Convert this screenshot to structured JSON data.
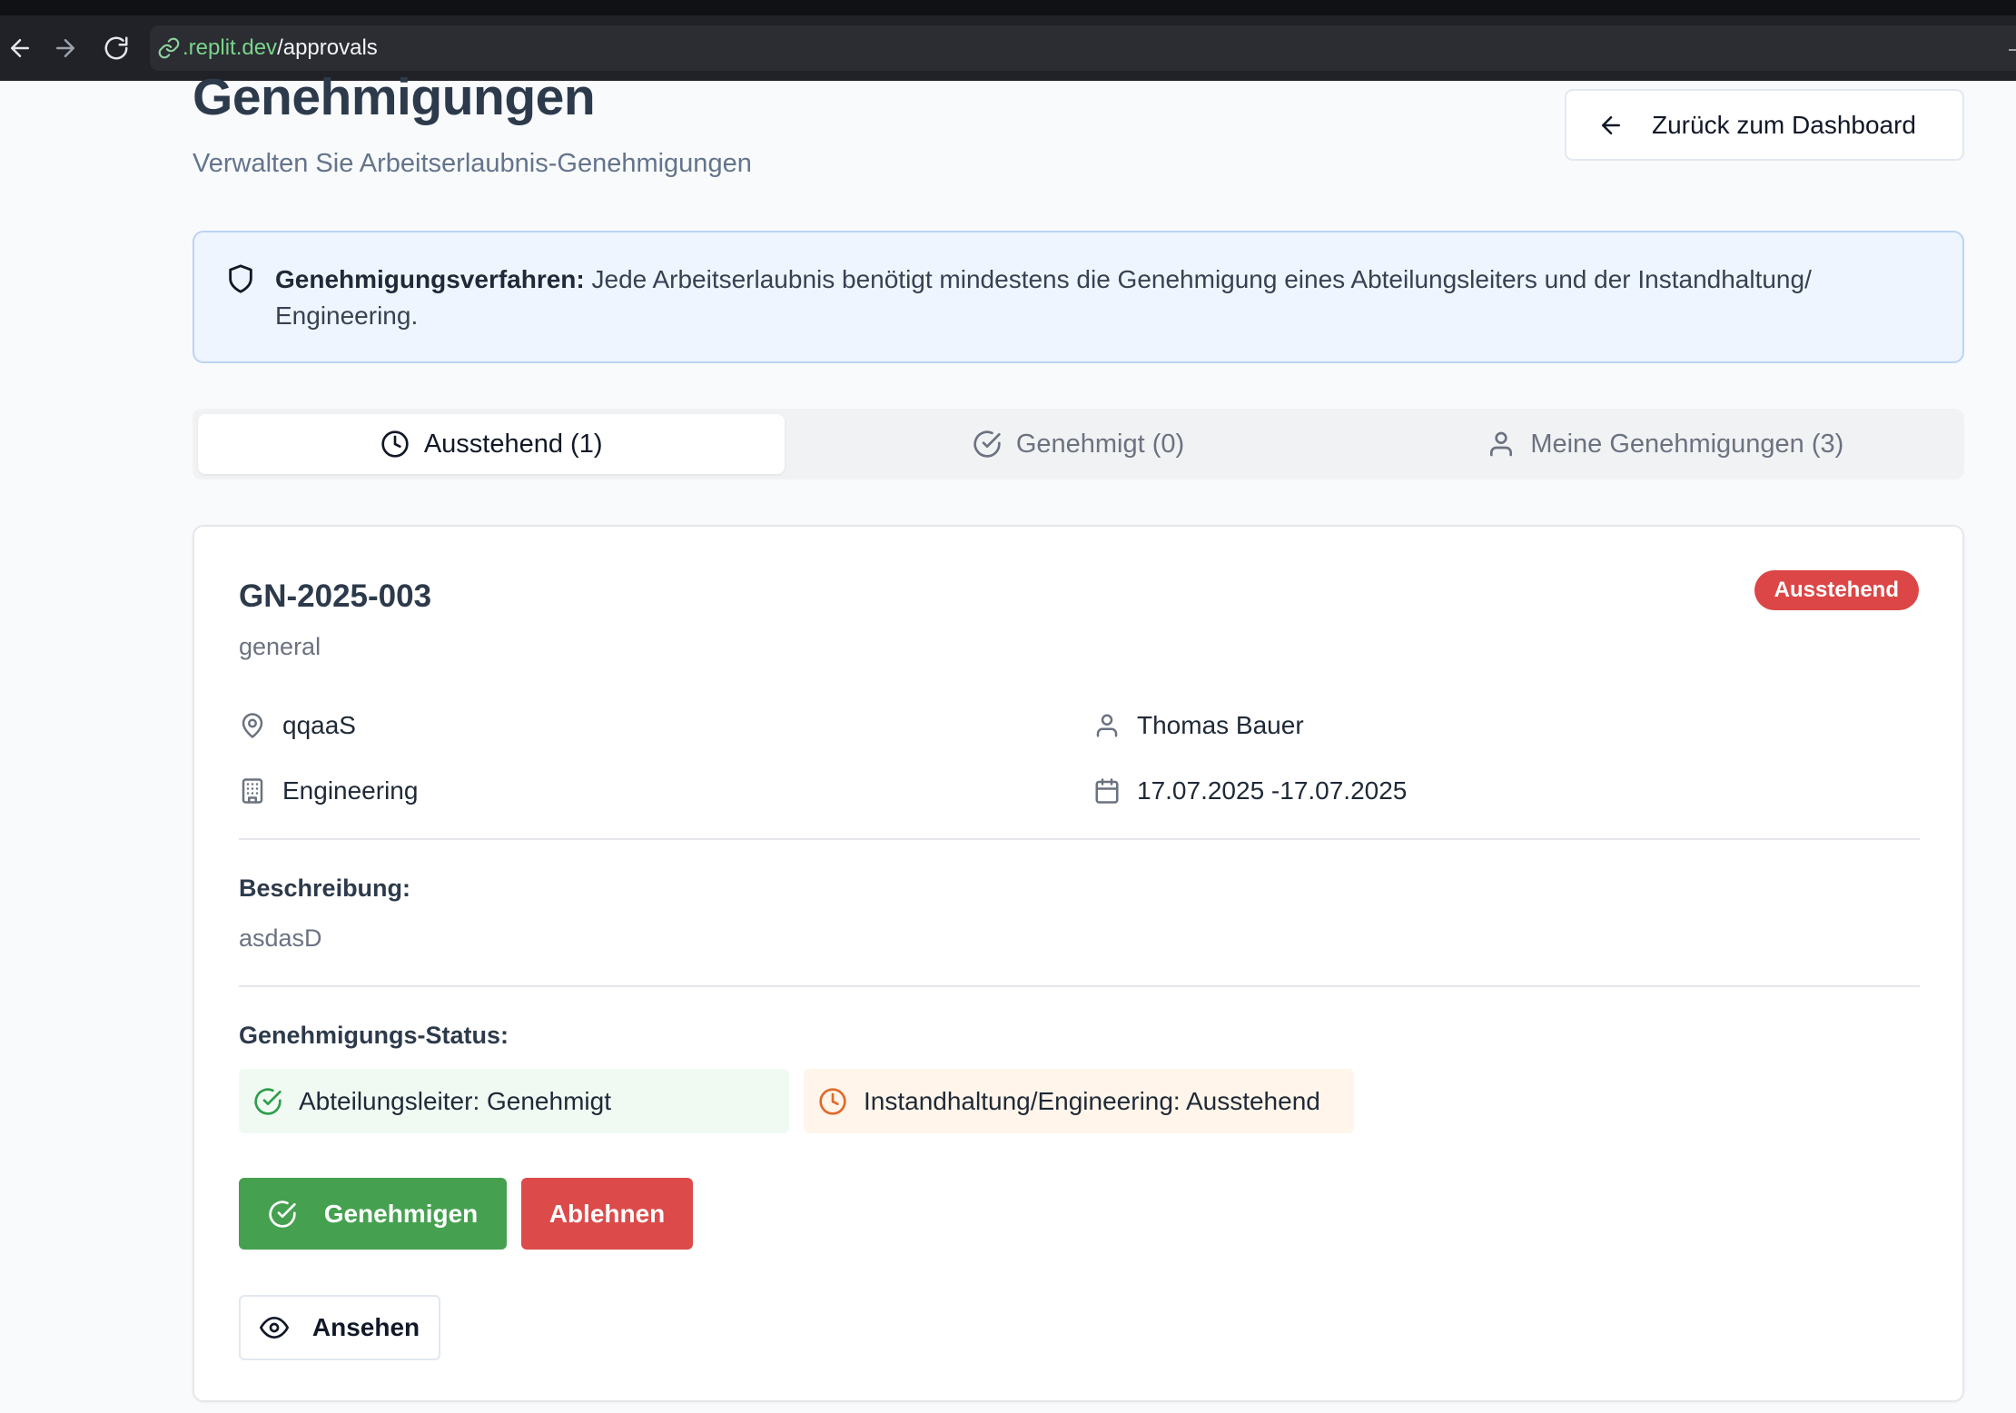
{
  "browser": {
    "url_host": ".replit.dev",
    "url_path": "/approvals",
    "icons": [
      "back-arrow-icon",
      "forward-arrow-icon",
      "reload-icon",
      "link-icon"
    ]
  },
  "header": {
    "title": "Genehmigungen",
    "subtitle": "Verwalten Sie Arbeitserlaubnis-Genehmigungen",
    "back_button": "Zurück zum Dashboard"
  },
  "info": {
    "label": "Genehmigungsverfahren:",
    "text": " Jede Arbeitserlaubnis benötigt mindestens die Genehmigung eines Abteilungsleiters und der Instandhaltung/ Engineering."
  },
  "tabs": [
    {
      "label": "Ausstehend (1)",
      "icon": "clock-icon",
      "active": true
    },
    {
      "label": "Genehmigt (0)",
      "icon": "check-circle-icon",
      "active": false
    },
    {
      "label": "Meine Genehmigungen (3)",
      "icon": "user-icon",
      "active": false
    }
  ],
  "permit": {
    "id": "GN-2025-003",
    "type": "general",
    "status_badge": "Ausstehend",
    "location": "qqaaS",
    "requester": "Thomas Bauer",
    "department": "Engineering",
    "date_range": "17.07.2025 -17.07.2025",
    "description_label": "Beschreibung:",
    "description": "asdasD",
    "approval_status_label": "Genehmigungs-Status:",
    "approvals": [
      {
        "text": "Abteilungsleiter: Genehmigt",
        "state": "approved"
      },
      {
        "text": "Instandhaltung/Engineering: Ausstehend",
        "state": "pending"
      }
    ],
    "actions": {
      "approve": "Genehmigen",
      "reject": "Ablehnen",
      "view": "Ansehen"
    }
  },
  "colors": {
    "accent_red": "#dc4646",
    "accent_green": "#45a14f",
    "info_bg": "#eef5ff",
    "pending_orange": "#e2692a"
  }
}
